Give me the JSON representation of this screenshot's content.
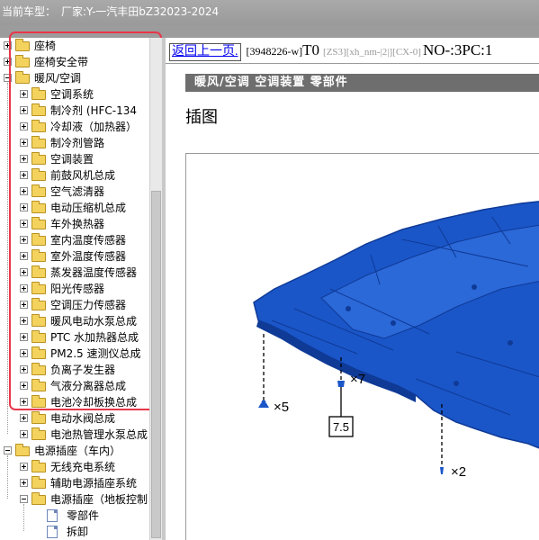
{
  "titlebar": {
    "label": "当前车型：",
    "manufacturer": "厂家:Y-一汽丰田bZ32023-2024"
  },
  "tree": {
    "nodes": [
      {
        "label": "座椅",
        "level": 0,
        "type": "folder",
        "expander": "plus",
        "open": false
      },
      {
        "label": "座椅安全带",
        "level": 0,
        "type": "folder",
        "expander": "plus",
        "open": false
      },
      {
        "label": "暖风/空调",
        "level": 0,
        "type": "folder",
        "expander": "minus",
        "open": true
      },
      {
        "label": "空调系统",
        "level": 1,
        "type": "folder",
        "expander": "plus",
        "open": false
      },
      {
        "label": "制冷剂 (HFC-134",
        "level": 1,
        "type": "folder",
        "expander": "plus",
        "open": false
      },
      {
        "label": "冷却液（加热器）",
        "level": 1,
        "type": "folder",
        "expander": "plus",
        "open": false
      },
      {
        "label": "制冷剂管路",
        "level": 1,
        "type": "folder",
        "expander": "plus",
        "open": false
      },
      {
        "label": "空调装置",
        "level": 1,
        "type": "folder",
        "expander": "plus",
        "open": false
      },
      {
        "label": "前鼓风机总成",
        "level": 1,
        "type": "folder",
        "expander": "plus",
        "open": false
      },
      {
        "label": "空气滤清器",
        "level": 1,
        "type": "folder",
        "expander": "plus",
        "open": false
      },
      {
        "label": "电动压缩机总成",
        "level": 1,
        "type": "folder",
        "expander": "plus",
        "open": false
      },
      {
        "label": "车外换热器",
        "level": 1,
        "type": "folder",
        "expander": "plus",
        "open": false
      },
      {
        "label": "室内温度传感器",
        "level": 1,
        "type": "folder",
        "expander": "plus",
        "open": false
      },
      {
        "label": "室外温度传感器",
        "level": 1,
        "type": "folder",
        "expander": "plus",
        "open": false
      },
      {
        "label": "蒸发器温度传感器",
        "level": 1,
        "type": "folder",
        "expander": "plus",
        "open": false
      },
      {
        "label": "阳光传感器",
        "level": 1,
        "type": "folder",
        "expander": "plus",
        "open": false
      },
      {
        "label": "空调压力传感器",
        "level": 1,
        "type": "folder",
        "expander": "plus",
        "open": false
      },
      {
        "label": "暖风电动水泵总成",
        "level": 1,
        "type": "folder",
        "expander": "plus",
        "open": false
      },
      {
        "label": "PTC 水加热器总成",
        "level": 1,
        "type": "folder",
        "expander": "plus",
        "open": false
      },
      {
        "label": "PM2.5 速测仪总成",
        "level": 1,
        "type": "folder",
        "expander": "plus",
        "open": false
      },
      {
        "label": "负离子发生器",
        "level": 1,
        "type": "folder",
        "expander": "plus",
        "open": false
      },
      {
        "label": "气液分离器总成",
        "level": 1,
        "type": "folder",
        "expander": "plus",
        "open": false
      },
      {
        "label": "电池冷却板换总成",
        "level": 1,
        "type": "folder",
        "expander": "plus",
        "open": false
      },
      {
        "label": "电动水阀总成",
        "level": 1,
        "type": "folder",
        "expander": "plus",
        "open": false
      },
      {
        "label": "电池热管理水泵总成",
        "level": 1,
        "type": "folder",
        "expander": "plus",
        "open": false
      },
      {
        "label": "电源插座（车内）",
        "level": 0,
        "type": "folder",
        "expander": "minus",
        "open": true
      },
      {
        "label": "无线充电系统",
        "level": 1,
        "type": "folder",
        "expander": "plus",
        "open": false
      },
      {
        "label": "辅助电源插座系统",
        "level": 1,
        "type": "folder",
        "expander": "plus",
        "open": false
      },
      {
        "label": "电源插座（地板控制",
        "level": 1,
        "type": "folder",
        "expander": "minus",
        "open": true
      },
      {
        "label": "零部件",
        "level": 2,
        "type": "doc",
        "expander": "none",
        "open": false
      },
      {
        "label": "拆卸",
        "level": 2,
        "type": "doc",
        "expander": "none",
        "open": false
      }
    ]
  },
  "content": {
    "back_link": "返回上一页.",
    "doc_code": "[3948226-w]",
    "t_code": "T0",
    "gray_codes": "[ZS3][xh_nm-|2|][CX-0]",
    "no_code": "NO-:3PC:1",
    "section_title": "暖风/空调  空调装置  零部件",
    "heading": "插图"
  },
  "figure": {
    "callouts": [
      {
        "label": "×5"
      },
      {
        "label": "×7"
      },
      {
        "label": "7.5"
      },
      {
        "label": "×2"
      }
    ]
  },
  "colors": {
    "part_blue": "#1a56c8",
    "part_dark": "#0f3a96",
    "highlight_red": "#e8364a",
    "section_bar": "#6e6e6e",
    "titlebar": "#a9a9a9"
  },
  "icons": [
    "folder-icon",
    "document-icon",
    "expand-plus-icon",
    "collapse-minus-icon"
  ]
}
